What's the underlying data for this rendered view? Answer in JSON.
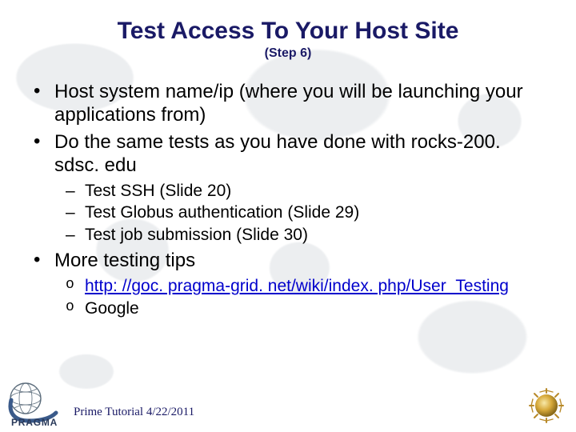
{
  "title": "Test Access To Your Host Site",
  "subtitle": "(Step 6)",
  "bullets": {
    "b1": "Host system name/ip (where you will be launching your applications from)",
    "b2": "Do the same tests as you have done with rocks-200. sdsc. edu",
    "b2_sub1": "Test SSH (Slide 20)",
    "b2_sub2": "Test Globus authentication (Slide 29)",
    "b2_sub3": "Test job submission (Slide 30)",
    "b3": "More testing tips",
    "b3_sub1_link": "http: //goc. pragma-grid. net/wiki/index. php/User_Testing",
    "b3_sub2": "Google"
  },
  "footer": "Prime Tutorial 4/22/2011"
}
